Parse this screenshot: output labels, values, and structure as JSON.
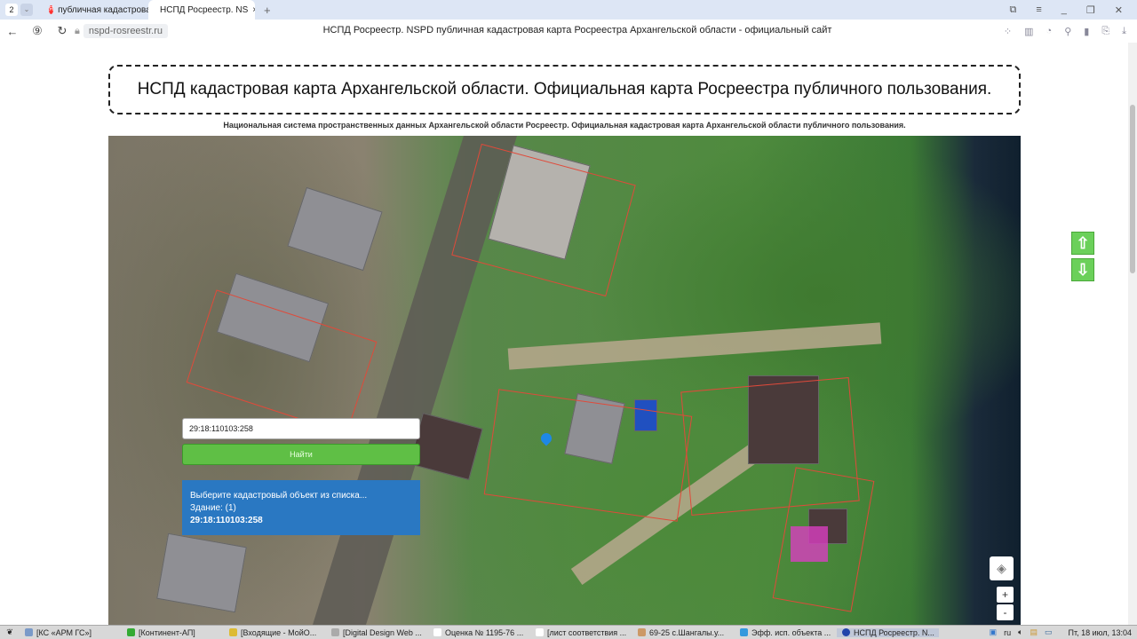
{
  "browser": {
    "tab_count": "2",
    "tabs": [
      {
        "label": "публичная кадастровая"
      },
      {
        "label": "НСПД Росреестр. NS"
      }
    ],
    "url": "nspd-rosreestr.ru",
    "page_title": "НСПД Росреестр. NSPD публичная кадастровая карта Росреестра Архангельской области - официальный сайт"
  },
  "page": {
    "heading": "НСПД кадастровая карта Архангельской области. Официальная карта Росреестра публичного пользования.",
    "subheading": "Национальная система пространственных данных Архангельской области Росреестр. Официальная кадастровая карта Архангельской области публичного пользования."
  },
  "map": {
    "search_value": "29:18:110103:258",
    "find_label": "Найти",
    "result": {
      "prompt": "Выберите кадастровый объект из списка...",
      "category": "Здание: (1)",
      "number": "29:18:110103:258"
    },
    "scroll_up": "⇧",
    "scroll_down": "⇩",
    "zoom_in": "+",
    "zoom_out": "-"
  },
  "taskbar": {
    "items": [
      "[КС «АРМ ГС»]",
      "[Континент-АП]",
      "[Входящие - МойО...",
      "[Digital Design Web ...",
      "Оценка № 1195-76 ...",
      "[лист соответствия ...",
      "69-25 с.Шангалы.у...",
      "Эфф. исп. объекта ...",
      "НСПД Росреестр. N..."
    ],
    "lang": "ru",
    "clock": "Пт, 18 июл, 13:04"
  }
}
